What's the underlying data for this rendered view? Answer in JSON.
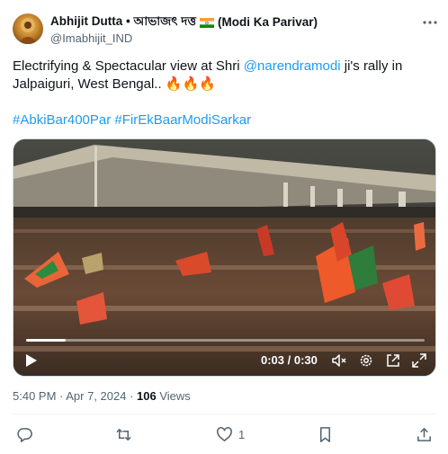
{
  "author": {
    "display_name": "Abhijit Dutta • আভাজৎ দত্ত",
    "suffix": "(Modi Ka Parivar)",
    "handle": "@Imabhijit_IND"
  },
  "tweet": {
    "text_part1": "Electrifying & Spectacular view at Shri ",
    "mention": "@narendramodi",
    "text_part2": " ji's rally in",
    "line2": "Jalpaiguri, West Bengal.. 🔥🔥🔥",
    "hashtags": "#AbkiBar400Par #FirEkBaarModiSarkar"
  },
  "video": {
    "time": "0:03 / 0:30",
    "progress": 0.1
  },
  "meta": {
    "timestamp": "5:40 PM · Apr 7, 2024 · ",
    "views_count": "106",
    "views_label": " Views"
  },
  "actions": {
    "like_count": "1"
  },
  "icons": [
    "more-icon",
    "play-icon",
    "volume-mute-icon",
    "settings-icon",
    "pip-icon",
    "fullscreen-icon",
    "reply-icon",
    "retweet-icon",
    "like-icon",
    "bookmark-icon",
    "share-icon"
  ],
  "colors": {
    "link": "#1d9bf0",
    "secondary_text": "#536471",
    "text": "#0f1419"
  }
}
